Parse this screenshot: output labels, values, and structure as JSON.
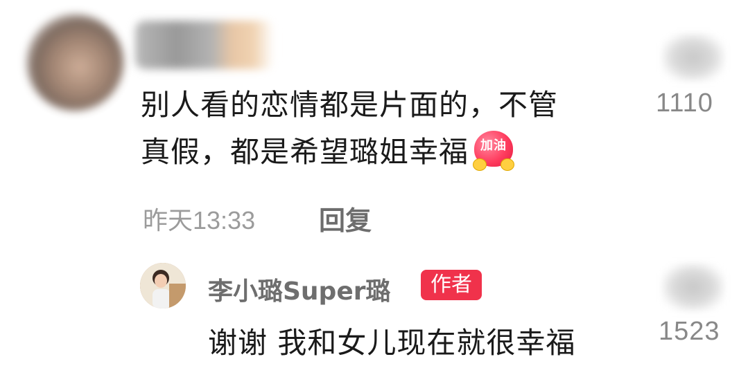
{
  "comment": {
    "text_line1": "别人看的恋情都是片面的，不管",
    "text_line2": "真假，都是希望璐姐幸福",
    "emoji_text": "加油",
    "likes": "1110",
    "time": "昨天13:33",
    "reply_label": "回复"
  },
  "reply": {
    "author_name": "李小璐Super璐",
    "author_tag": "作者",
    "text": "谢谢 我和女儿现在就很幸福",
    "likes": "1523"
  },
  "icons": {
    "like": "heart-like-icon",
    "emoji": "jiayou-heart-emoji"
  },
  "colors": {
    "author_tag_bg": "#f0324b",
    "meta_text": "#9b9b9b",
    "main_text": "#1a1a1a"
  }
}
